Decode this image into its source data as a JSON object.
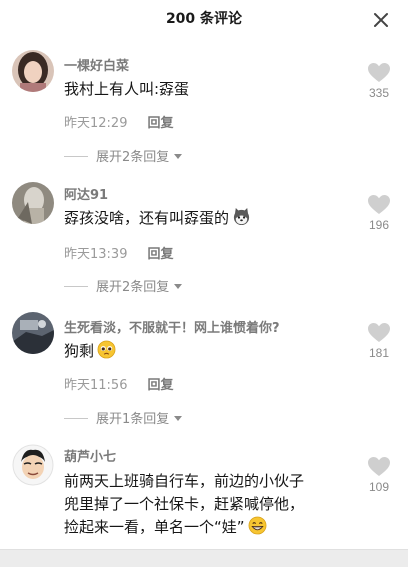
{
  "header": {
    "title": "200 条评论"
  },
  "comments": [
    {
      "username": "一棵好白菜",
      "text": "我村上有人叫:孬蛋",
      "emoji": "",
      "time": "昨天12:29",
      "reply_label": "回复",
      "expand_label": "展开2条回复",
      "likes": "335"
    },
    {
      "username": "阿达91",
      "text": "孬孩没啥，还有叫孬蛋的",
      "emoji": "husky-emoji",
      "time": "昨天13:39",
      "reply_label": "回复",
      "expand_label": "展开2条回复",
      "likes": "196"
    },
    {
      "username": "生死看淡，不服就干！网上谁惯着你?",
      "text": "狗剩",
      "emoji": "pleading-emoji",
      "time": "昨天11:56",
      "reply_label": "回复",
      "expand_label": "展开1条回复",
      "likes": "181"
    },
    {
      "username": "葫芦小七",
      "text_lines": [
        "前两天上班骑自行车，前边的小伙子",
        "兜里掉了一个社保卡，赶紧喊停他，",
        "捡起来一看，单名一个“娃”"
      ],
      "emoji": "grin-emoji",
      "likes": "109"
    }
  ]
}
